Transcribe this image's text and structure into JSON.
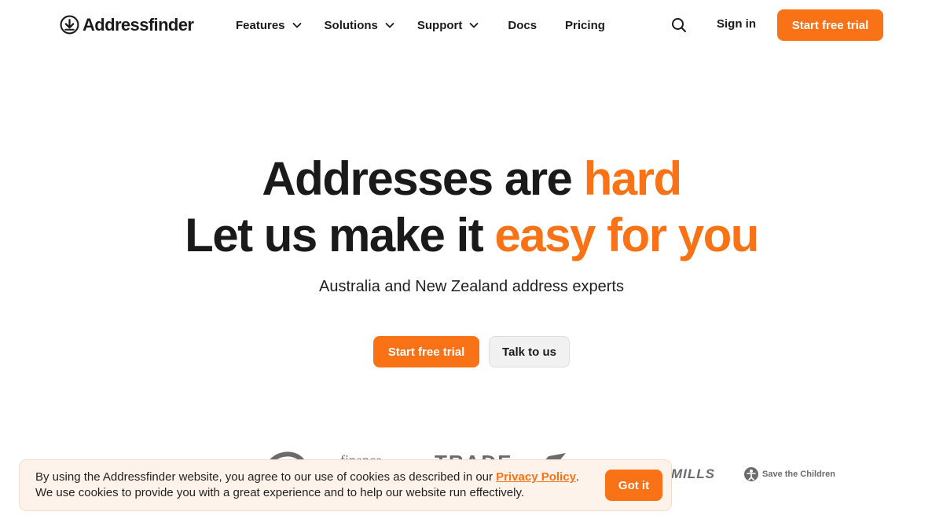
{
  "header": {
    "logo_text": "Addressfinder",
    "nav": [
      {
        "label": "Features",
        "dropdown": true
      },
      {
        "label": "Solutions",
        "dropdown": true
      },
      {
        "label": "Support",
        "dropdown": true
      },
      {
        "label": "Docs",
        "dropdown": false
      },
      {
        "label": "Pricing",
        "dropdown": false
      }
    ],
    "search_icon": "search-icon",
    "signin_label": "Sign in",
    "cta_label": "Start free trial"
  },
  "hero": {
    "line1_prefix": "Addresses are ",
    "line1_accent": "hard",
    "line2_prefix": "Let us make it ",
    "line2_accent": "easy for you",
    "subtitle": "Australia and New Zealand address experts",
    "primary_cta": "Start free trial",
    "secondary_cta": "Talk to us"
  },
  "logos": [
    {
      "name": "customer-logo-swirl"
    },
    {
      "name": "customer-logo-finance",
      "text": "finance"
    },
    {
      "name": "customer-logo-trade",
      "text": "TRADE"
    },
    {
      "name": "customer-logo-bird"
    },
    {
      "name": "customer-logo-mills",
      "text": "MILLS"
    },
    {
      "name": "customer-logo-save-the-children",
      "text": "Save the Children"
    }
  ],
  "cookie": {
    "text_before_link": "By using the Addressfinder website, you agree to our use of cookies as described in our ",
    "link_label": "Privacy Policy",
    "text_after_link": ".",
    "text_line2": "We use cookies to provide you with a great experience and to help our website run effectively.",
    "button_label": "Got it"
  },
  "colors": {
    "accent": "#f97316",
    "text": "#1a1a1a",
    "cookie_bg": "#fdf3ea"
  }
}
